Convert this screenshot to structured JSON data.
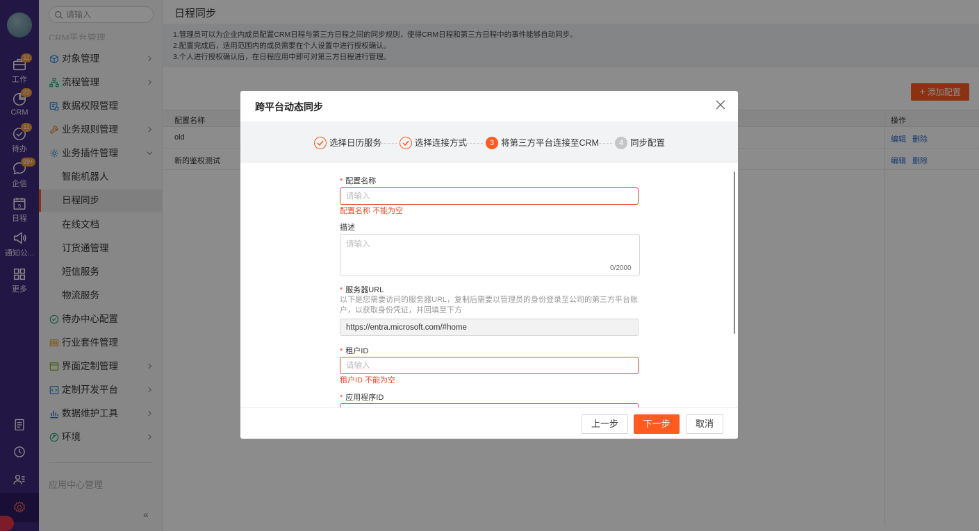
{
  "rail": {
    "items": [
      {
        "label": "工作",
        "badge": "11",
        "icon": "briefcase-icon"
      },
      {
        "label": "CRM",
        "badge": "22",
        "icon": "pie-chart-icon"
      },
      {
        "label": "待办",
        "badge": "11",
        "icon": "check-circle-icon"
      },
      {
        "label": "企信",
        "badge": "99+",
        "icon": "chat-bubble-icon"
      },
      {
        "label": "日程",
        "badge": "",
        "icon": "calendar-icon",
        "day": "5"
      },
      {
        "label": "通知公...",
        "badge": "",
        "icon": "megaphone-icon"
      },
      {
        "label": "更多",
        "badge": "",
        "icon": "grid-icon"
      }
    ]
  },
  "sidebar": {
    "search_placeholder": "请输入",
    "section_title": "CRM平台管理",
    "menu": [
      {
        "label": "对象管理",
        "icon": "cube-icon",
        "chevron": "right"
      },
      {
        "label": "流程管理",
        "icon": "flow-icon",
        "chevron": "right"
      },
      {
        "label": "数据权限管理",
        "icon": "data-lock-icon",
        "chevron": ""
      },
      {
        "label": "业务规则管理",
        "icon": "wrench-icon",
        "chevron": "right"
      },
      {
        "label": "业务插件管理",
        "icon": "plugin-icon",
        "chevron": "down"
      }
    ],
    "sub_menu": [
      {
        "label": "智能机器人",
        "active": false
      },
      {
        "label": "日程同步",
        "active": true
      },
      {
        "label": "在线文档",
        "active": false
      },
      {
        "label": "订货通管理",
        "active": false
      },
      {
        "label": "短信服务",
        "active": false
      },
      {
        "label": "物流服务",
        "active": false
      }
    ],
    "menu2": [
      {
        "label": "待办中心配置",
        "icon": "check-icon",
        "chevron": ""
      },
      {
        "label": "行业套件管理",
        "icon": "suite-icon",
        "chevron": ""
      },
      {
        "label": "界面定制管理",
        "icon": "layout-icon",
        "chevron": "right"
      },
      {
        "label": "定制开发平台",
        "icon": "code-icon",
        "chevron": "right"
      },
      {
        "label": "数据维护工具",
        "icon": "bar-chart-icon",
        "chevron": "right"
      },
      {
        "label": "环境",
        "icon": "env-icon",
        "chevron": "right"
      }
    ],
    "footer_section": "应用中心管理",
    "collapse_glyph": "«"
  },
  "main": {
    "title": "日程同步",
    "notice": [
      "1.管理员可以为企业内成员配置CRM日程与第三方日程之间的同步规则，使得CRM日程和第三方日程中的事件能够自动同步。",
      "2.配置完成后，适用范围内的成员需要在个人设置中进行授权确认。",
      "3.个人进行授权确认后，在日程应用中即可对第三方日程进行管理。"
    ],
    "add_button": "添加配置",
    "table": {
      "col_name": "配置名称",
      "col_ops": "操作",
      "rows": [
        {
          "name": "old",
          "edit": "编辑",
          "delete": "删除"
        },
        {
          "name": "新的鉴权测试",
          "edit": "编辑",
          "delete": "删除"
        }
      ]
    }
  },
  "modal": {
    "title": "跨平台动态同步",
    "steps": [
      {
        "num": "1",
        "label": "选择日历服务",
        "state": "done"
      },
      {
        "num": "2",
        "label": "选择连接方式",
        "state": "done"
      },
      {
        "num": "3",
        "label": "将第三方平台连接至CRM",
        "state": "current"
      },
      {
        "num": "4",
        "label": "同步配置",
        "state": "todo"
      }
    ],
    "form": {
      "name_label": "配置名称",
      "name_placeholder": "请输入",
      "name_error": "配置名称 不能为空",
      "desc_label": "描述",
      "desc_placeholder": "请输入",
      "desc_counter": "0/2000",
      "url_label": "服务器URL",
      "url_hint": "以下是您需要访问的服务器URL，复制后需要以管理员的身份登录至公司的第三方平台账户，以获取身份凭证，并回填至下方",
      "url_value": "https://entra.microsoft.com/#home",
      "tenant_label": "租户ID",
      "tenant_placeholder": "请输入",
      "tenant_error": "租户ID 不能为空",
      "app_label": "应用程序ID"
    },
    "footer": {
      "prev": "上一步",
      "next": "下一步",
      "cancel": "取消"
    }
  },
  "colors": {
    "accent": "#ff5a1f",
    "rail": "#3f2a7d",
    "error": "#e84a2b",
    "link": "#2e6ad1"
  }
}
